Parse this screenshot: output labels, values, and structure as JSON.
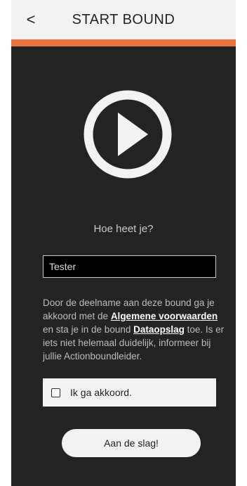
{
  "header": {
    "back_label": "<",
    "title": "START BOUND"
  },
  "main": {
    "question": "Hoe heet je?",
    "name_input_value": "Tester",
    "terms": {
      "part1": "Door de deelname aan deze bound ga je akkoord met de ",
      "link1": "Algemene voorwaarden",
      "part2": " en sta je in de bound ",
      "link2": "Dataopslag",
      "part3": " toe. Is er iets niet helemaal duidelijk, informeer bij jullie Actionboundleider."
    },
    "agree_label": "Ik ga akkoord.",
    "start_button": "Aan de slag!"
  },
  "colors": {
    "accent": "#f0743e",
    "background_dark": "#232323",
    "header_bg": "#f3f2f0"
  }
}
